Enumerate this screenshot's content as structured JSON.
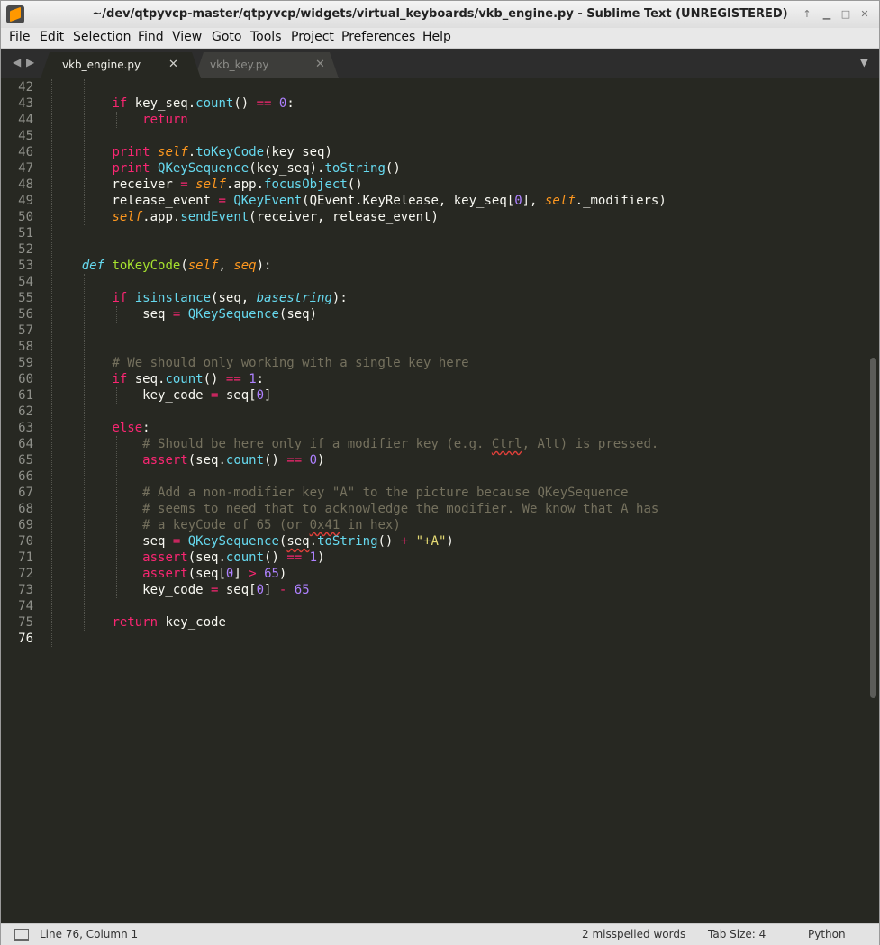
{
  "window": {
    "title": "~/dev/qtpyvcp-master/qtpyvcp/widgets/virtual_keyboards/vkb_engine.py - Sublime Text (UNREGISTERED)"
  },
  "menu": [
    "File",
    "Edit",
    "Selection",
    "Find",
    "View",
    "Goto",
    "Tools",
    "Project",
    "Preferences",
    "Help"
  ],
  "tabs": [
    {
      "label": "vkb_engine.py",
      "active": true
    },
    {
      "label": "vkb_key.py",
      "active": false
    }
  ],
  "icons": {
    "close": "close-icon",
    "tab_nav": "arrow-icon",
    "dropdown": "chevron-down-icon"
  },
  "editor": {
    "theme": {
      "background": "#272822",
      "keyword": "#f92672",
      "function": "#66d9ef",
      "definition": "#a6e22e",
      "param": "#fd971f",
      "number": "#ae81ff",
      "string": "#e6db74",
      "comment": "#75715e"
    },
    "current_line": 76,
    "lines": [
      {
        "n": "42",
        "segs": []
      },
      {
        "n": "43",
        "segs": [
          [
            "        ",
            ""
          ],
          [
            "if",
            "kw"
          ],
          [
            " key_seq.",
            ""
          ],
          [
            "count",
            "fn"
          ],
          [
            "() ",
            ""
          ],
          [
            "==",
            "op"
          ],
          [
            " ",
            ""
          ],
          [
            "0",
            "num"
          ],
          [
            ":",
            ""
          ]
        ]
      },
      {
        "n": "44",
        "segs": [
          [
            "            ",
            ""
          ],
          [
            "return",
            "kw"
          ]
        ]
      },
      {
        "n": "45",
        "segs": []
      },
      {
        "n": "46",
        "segs": [
          [
            "        ",
            ""
          ],
          [
            "print",
            "kw"
          ],
          [
            " ",
            ""
          ],
          [
            "self",
            "self"
          ],
          [
            ".",
            ""
          ],
          [
            "toKeyCode",
            "fn"
          ],
          [
            "(key_seq)",
            ""
          ]
        ]
      },
      {
        "n": "47",
        "segs": [
          [
            "        ",
            ""
          ],
          [
            "print",
            "kw"
          ],
          [
            " ",
            ""
          ],
          [
            "QKeySequence",
            "fn"
          ],
          [
            "(key_seq).",
            ""
          ],
          [
            "toString",
            "fn"
          ],
          [
            "()",
            ""
          ]
        ]
      },
      {
        "n": "48",
        "segs": [
          [
            "        receiver ",
            ""
          ],
          [
            "=",
            "op"
          ],
          [
            " ",
            ""
          ],
          [
            "self",
            "self"
          ],
          [
            ".app.",
            ""
          ],
          [
            "focusObject",
            "fn"
          ],
          [
            "()",
            ""
          ]
        ]
      },
      {
        "n": "49",
        "segs": [
          [
            "        release_event ",
            ""
          ],
          [
            "=",
            "op"
          ],
          [
            " ",
            ""
          ],
          [
            "QKeyEvent",
            "fn"
          ],
          [
            "(QEvent.KeyRelease, key_seq[",
            ""
          ],
          [
            "0",
            "num"
          ],
          [
            "], ",
            ""
          ],
          [
            "self",
            "self"
          ],
          [
            "._modifiers)",
            ""
          ]
        ]
      },
      {
        "n": "50",
        "segs": [
          [
            "        ",
            ""
          ],
          [
            "self",
            "self"
          ],
          [
            ".app.",
            ""
          ],
          [
            "sendEvent",
            "fn"
          ],
          [
            "(receiver, release_event)",
            ""
          ]
        ]
      },
      {
        "n": "51",
        "segs": []
      },
      {
        "n": "52",
        "segs": []
      },
      {
        "n": "53",
        "segs": [
          [
            "    ",
            ""
          ],
          [
            "def",
            "def"
          ],
          [
            " ",
            ""
          ],
          [
            "toKeyCode",
            "fname"
          ],
          [
            "(",
            ""
          ],
          [
            "self",
            "param"
          ],
          [
            ", ",
            ""
          ],
          [
            "seq",
            "param"
          ],
          [
            "):",
            ""
          ]
        ]
      },
      {
        "n": "54",
        "segs": []
      },
      {
        "n": "55",
        "segs": [
          [
            "        ",
            ""
          ],
          [
            "if",
            "kw"
          ],
          [
            " ",
            ""
          ],
          [
            "isinstance",
            "fn"
          ],
          [
            "(seq, ",
            ""
          ],
          [
            "basestring",
            "bi"
          ],
          [
            "):",
            ""
          ]
        ]
      },
      {
        "n": "56",
        "segs": [
          [
            "            seq ",
            ""
          ],
          [
            "=",
            "op"
          ],
          [
            " ",
            ""
          ],
          [
            "QKeySequence",
            "fn"
          ],
          [
            "(seq)",
            ""
          ]
        ]
      },
      {
        "n": "57",
        "segs": []
      },
      {
        "n": "58",
        "segs": []
      },
      {
        "n": "59",
        "segs": [
          [
            "        ",
            ""
          ],
          [
            "# We should only working with a single key here",
            "cm"
          ]
        ]
      },
      {
        "n": "60",
        "segs": [
          [
            "        ",
            ""
          ],
          [
            "if",
            "kw"
          ],
          [
            " seq.",
            ""
          ],
          [
            "count",
            "fn"
          ],
          [
            "() ",
            ""
          ],
          [
            "==",
            "op"
          ],
          [
            " ",
            ""
          ],
          [
            "1",
            "num"
          ],
          [
            ":",
            ""
          ]
        ]
      },
      {
        "n": "61",
        "segs": [
          [
            "            key_code ",
            ""
          ],
          [
            "=",
            "op"
          ],
          [
            " seq[",
            ""
          ],
          [
            "0",
            "num"
          ],
          [
            "]",
            ""
          ]
        ]
      },
      {
        "n": "62",
        "segs": []
      },
      {
        "n": "63",
        "segs": [
          [
            "        ",
            ""
          ],
          [
            "else",
            "kw"
          ],
          [
            ":",
            ""
          ]
        ]
      },
      {
        "n": "64",
        "segs": [
          [
            "            ",
            ""
          ],
          [
            "# Should be here only if a modifier key (e.g. ",
            "cm"
          ],
          [
            "Ctrl",
            "cm spell"
          ],
          [
            ", Alt) is pressed.",
            "cm"
          ]
        ]
      },
      {
        "n": "65",
        "segs": [
          [
            "            ",
            ""
          ],
          [
            "assert",
            "kw"
          ],
          [
            "(seq.",
            ""
          ],
          [
            "count",
            "fn"
          ],
          [
            "() ",
            ""
          ],
          [
            "==",
            "op"
          ],
          [
            " ",
            ""
          ],
          [
            "0",
            "num"
          ],
          [
            ")",
            ""
          ]
        ]
      },
      {
        "n": "66",
        "segs": []
      },
      {
        "n": "67",
        "segs": [
          [
            "            ",
            ""
          ],
          [
            "# Add a non-modifier key \"A\" to the picture because QKeySequence",
            "cm"
          ]
        ]
      },
      {
        "n": "68",
        "segs": [
          [
            "            ",
            ""
          ],
          [
            "# seems to need that to acknowledge the modifier. We know that A has",
            "cm"
          ]
        ]
      },
      {
        "n": "69",
        "segs": [
          [
            "            ",
            ""
          ],
          [
            "# a keyCode of 65 (or ",
            "cm"
          ],
          [
            "0x41",
            "cm spell"
          ],
          [
            " in hex)",
            "cm"
          ]
        ]
      },
      {
        "n": "70",
        "segs": [
          [
            "            seq ",
            ""
          ],
          [
            "=",
            "op"
          ],
          [
            " ",
            ""
          ],
          [
            "QKeySequence",
            "fn"
          ],
          [
            "(",
            ""
          ],
          [
            "seq",
            "spell"
          ],
          [
            ".",
            ""
          ],
          [
            "toString",
            "fn"
          ],
          [
            "() ",
            ""
          ],
          [
            "+",
            "op"
          ],
          [
            " ",
            ""
          ],
          [
            "\"+A\"",
            "str"
          ],
          [
            ")",
            ""
          ]
        ]
      },
      {
        "n": "71",
        "segs": [
          [
            "            ",
            ""
          ],
          [
            "assert",
            "kw"
          ],
          [
            "(seq.",
            ""
          ],
          [
            "count",
            "fn"
          ],
          [
            "() ",
            ""
          ],
          [
            "==",
            "op"
          ],
          [
            " ",
            ""
          ],
          [
            "1",
            "num"
          ],
          [
            ")",
            ""
          ]
        ]
      },
      {
        "n": "72",
        "segs": [
          [
            "            ",
            ""
          ],
          [
            "assert",
            "kw"
          ],
          [
            "(seq[",
            ""
          ],
          [
            "0",
            "num"
          ],
          [
            "] ",
            ""
          ],
          [
            ">",
            "op"
          ],
          [
            " ",
            ""
          ],
          [
            "65",
            "num"
          ],
          [
            ")",
            ""
          ]
        ]
      },
      {
        "n": "73",
        "segs": [
          [
            "            key_code ",
            ""
          ],
          [
            "=",
            "op"
          ],
          [
            " seq[",
            ""
          ],
          [
            "0",
            "num"
          ],
          [
            "] ",
            ""
          ],
          [
            "-",
            "op"
          ],
          [
            " ",
            ""
          ],
          [
            "65",
            "num"
          ]
        ]
      },
      {
        "n": "74",
        "segs": []
      },
      {
        "n": "75",
        "segs": [
          [
            "        ",
            ""
          ],
          [
            "return",
            "kw"
          ],
          [
            " key_code",
            ""
          ]
        ]
      },
      {
        "n": "76",
        "segs": []
      }
    ]
  },
  "status": {
    "position": "Line 76, Column 1",
    "spelling": "2 misspelled words",
    "tab_size": "Tab Size: 4",
    "syntax": "Python"
  }
}
